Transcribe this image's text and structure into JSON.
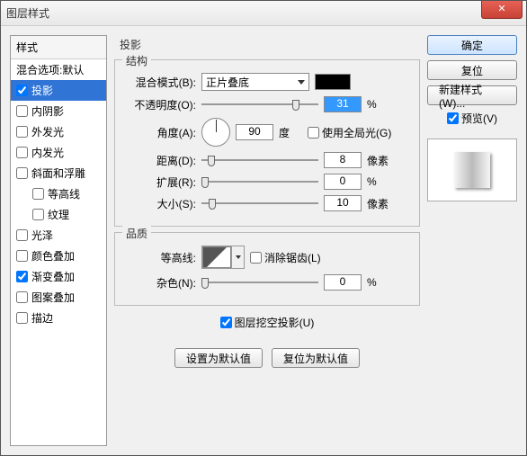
{
  "title": "图层样式",
  "close_glyph": "✕",
  "left": {
    "header": "样式",
    "blend_options": "混合选项:默认",
    "items": [
      {
        "label": "投影",
        "checked": true,
        "selected": true
      },
      {
        "label": "内阴影",
        "checked": false
      },
      {
        "label": "外发光",
        "checked": false
      },
      {
        "label": "内发光",
        "checked": false
      },
      {
        "label": "斜面和浮雕",
        "checked": false
      },
      {
        "label": "等高线",
        "checked": false,
        "indent": true
      },
      {
        "label": "纹理",
        "checked": false,
        "indent": true
      },
      {
        "label": "光泽",
        "checked": false
      },
      {
        "label": "颜色叠加",
        "checked": false
      },
      {
        "label": "渐变叠加",
        "checked": true
      },
      {
        "label": "图案叠加",
        "checked": false
      },
      {
        "label": "描边",
        "checked": false
      }
    ]
  },
  "center": {
    "title": "投影",
    "structure": {
      "legend": "结构",
      "blend_mode_label": "混合模式(B):",
      "blend_mode_value": "正片叠底",
      "color": "#000000",
      "opacity_label": "不透明度(O):",
      "opacity_value": "31",
      "opacity_unit": "%",
      "angle_label": "角度(A):",
      "angle_value": "90",
      "angle_unit": "度",
      "global_light_label": "使用全局光(G)",
      "distance_label": "距离(D):",
      "distance_value": "8",
      "distance_unit": "像素",
      "spread_label": "扩展(R):",
      "spread_value": "0",
      "spread_unit": "%",
      "size_label": "大小(S):",
      "size_value": "10",
      "size_unit": "像素"
    },
    "quality": {
      "legend": "品质",
      "contour_label": "等高线:",
      "antialias_label": "消除锯齿(L)",
      "noise_label": "杂色(N):",
      "noise_value": "0",
      "noise_unit": "%"
    },
    "knockout_label": "图层挖空投影(U)",
    "set_default": "设置为默认值",
    "reset_default": "复位为默认值"
  },
  "right": {
    "ok": "确定",
    "cancel": "复位",
    "new_style": "新建样式(W)...",
    "preview_label": "预览(V)"
  }
}
